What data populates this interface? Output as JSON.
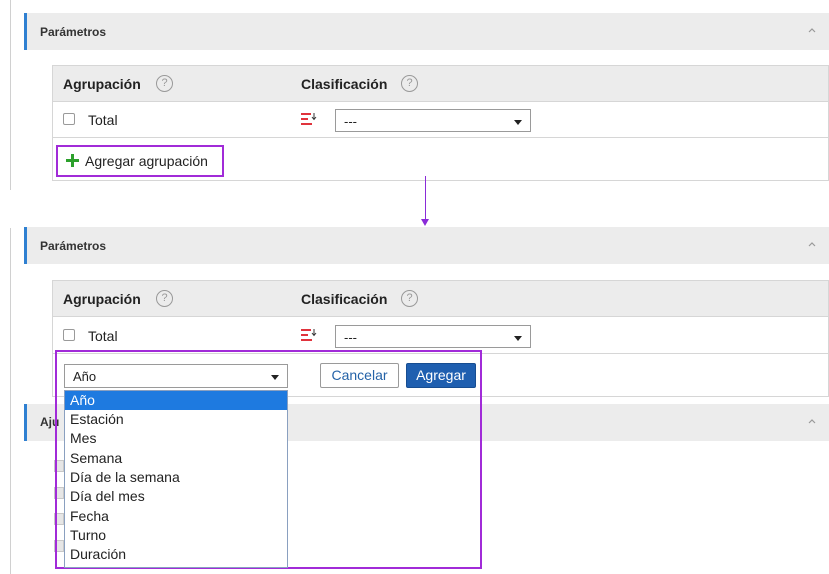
{
  "top_section": {
    "panel_title": "Parámetros",
    "headers": {
      "grouping": "Agrupación",
      "classification": "Clasificación",
      "help_glyph": "?"
    },
    "row": {
      "label": "Total",
      "select_value": "---"
    },
    "add_grouping_label": "Agregar agrupación"
  },
  "bottom_section": {
    "panel_title": "Parámetros",
    "headers": {
      "grouping": "Agrupación",
      "classification": "Clasificación",
      "help_glyph": "?"
    },
    "row": {
      "label": "Total",
      "select_value": "---"
    },
    "grouping_select_value": "Año",
    "cancel_label": "Cancelar",
    "add_label": "Agregar",
    "dropdown_options": [
      "Año",
      "Estación",
      "Mes",
      "Semana",
      "Día de la semana",
      "Día del mes",
      "Fecha",
      "Turno",
      "Duración"
    ],
    "hidden_panel_title": "Aju"
  },
  "colors": {
    "accent_border": "#2f80d1",
    "highlight": "#a12bd8",
    "primary_button": "#1f5fb0",
    "option_selected": "#1e7ae0",
    "plus_icon": "#2ca02c",
    "sort_icon": "#e0333c"
  }
}
